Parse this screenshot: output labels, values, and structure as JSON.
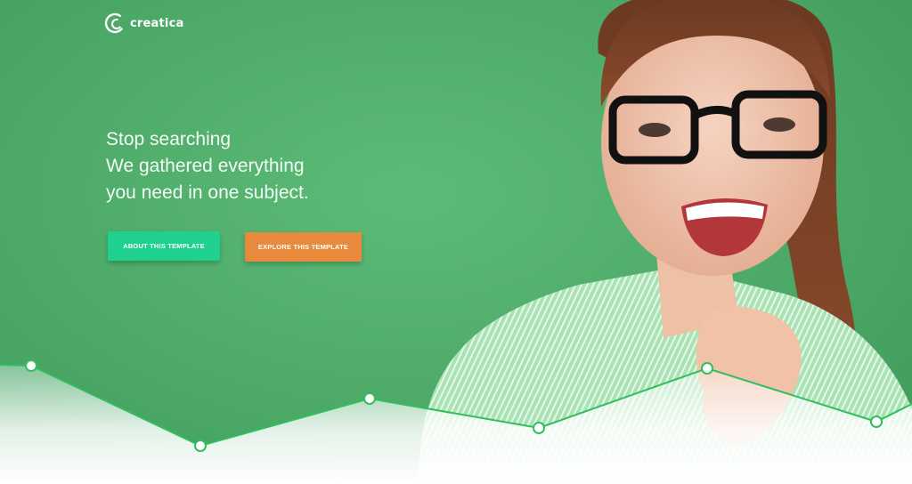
{
  "brand": {
    "name": "creatica",
    "logo_icon": "creatica-logo-mark"
  },
  "hero": {
    "headline_lines": [
      "Stop searching",
      "We gathered everything",
      "you need in one subject."
    ],
    "buttons": {
      "about": "ABOUT THIS TEMPLATE",
      "explore": "EXPLORE THIS TEMPLATE"
    }
  },
  "colors": {
    "background_green": "#4fac6a",
    "about_button": "#1fd18f",
    "explore_button": "#e8893b",
    "wave_line": "#2fbf5f"
  }
}
